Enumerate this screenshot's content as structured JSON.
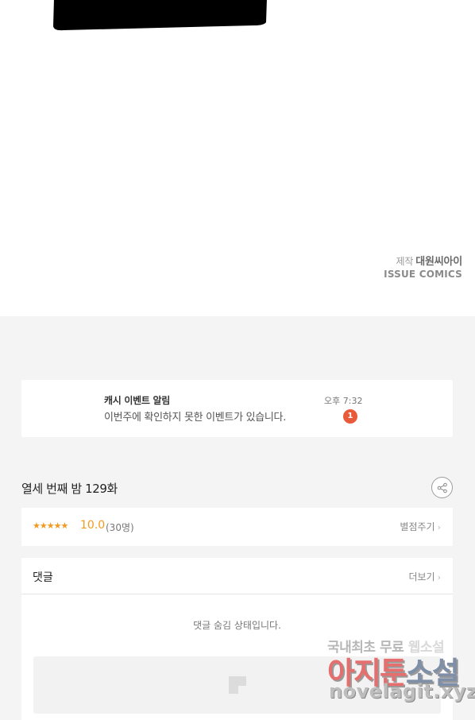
{
  "comic": {
    "credit_label": "제작",
    "credit_studio": "대원씨아이",
    "credit_publisher": "ISSUE COMICS"
  },
  "notice": {
    "title": "캐시 이벤트 알림",
    "message": "이번주에 확인하지 못한 이벤트가 있습니다.",
    "time": "오후 7:32",
    "badge_count": "1"
  },
  "episode": {
    "title": "열세 번째 밤 129화",
    "share_icon": "share-icon"
  },
  "rating": {
    "stars": "★★★★★",
    "score": "10.0",
    "count": "(30명)",
    "rate_link": "별점주기"
  },
  "comments": {
    "title": "댓글",
    "more_link": "더보기",
    "hidden_message": "댓글 숨김 상태입니다."
  },
  "watermark": {
    "line1_a": "국내최초 무료",
    "line1_b": "웹소설",
    "line2_a": "아지툰",
    "line2_b": "소설",
    "line3": "novelagit.xyz"
  },
  "colors": {
    "accent_star": "#f29a1f",
    "badge": "#e85a3a",
    "background_gray": "#f4f4f4"
  }
}
